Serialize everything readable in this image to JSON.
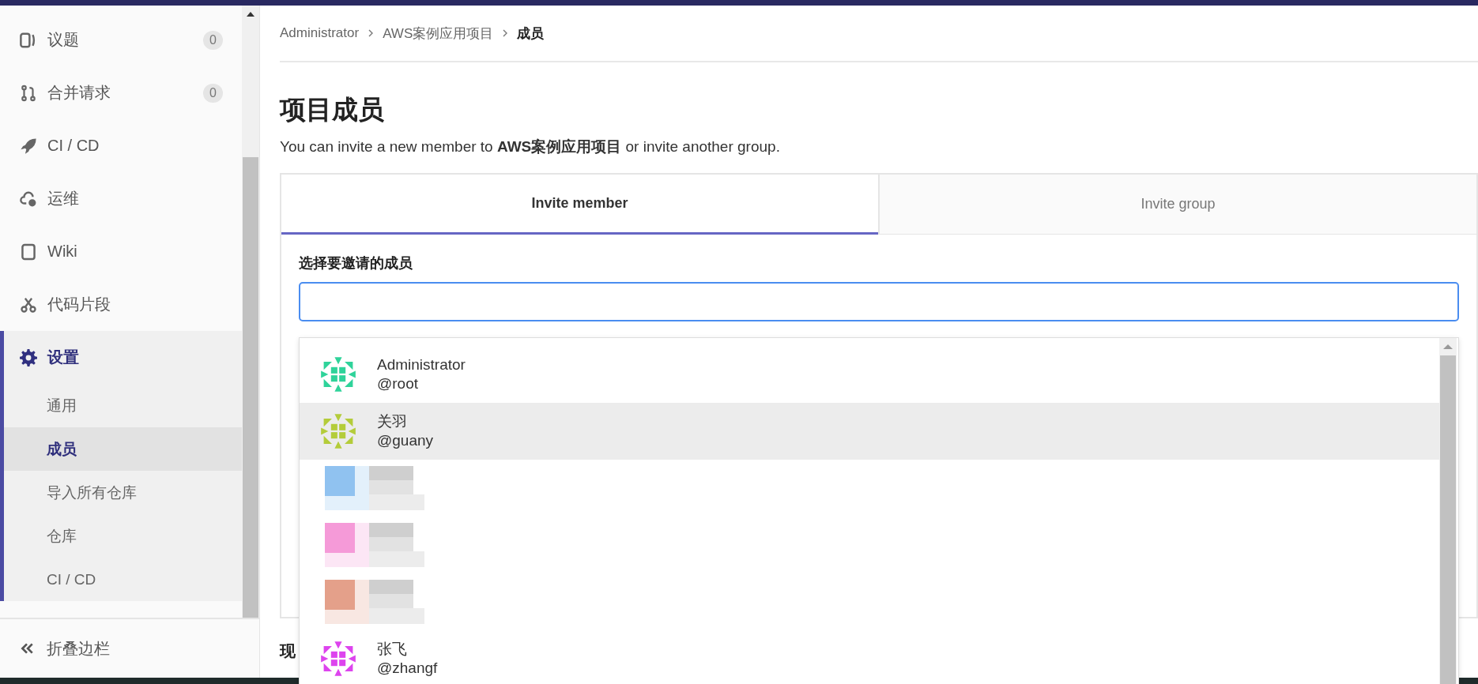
{
  "sidebar": {
    "items": [
      {
        "label": "议题",
        "badge": "0"
      },
      {
        "label": "合并请求",
        "badge": "0"
      },
      {
        "label": "CI / CD"
      },
      {
        "label": "运维"
      },
      {
        "label": "Wiki"
      },
      {
        "label": "代码片段"
      },
      {
        "label": "设置",
        "expanded": true,
        "children": [
          {
            "label": "通用",
            "selected": false
          },
          {
            "label": "成员",
            "selected": true
          },
          {
            "label": "导入所有仓库",
            "selected": false
          },
          {
            "label": "仓库",
            "selected": false
          },
          {
            "label": "CI / CD",
            "selected": false
          }
        ]
      }
    ],
    "collapse": "折叠边栏"
  },
  "breadcrumb": [
    "Administrator",
    "AWS案例应用项目",
    "成员"
  ],
  "title": "项目成员",
  "description": "You can invite a new member to **AWS案例应用项目** or invite another group.",
  "tabs": [
    {
      "label": "Invite member",
      "selected": true
    },
    {
      "label": "Invite group",
      "selected": false
    }
  ],
  "invite": {
    "label": "选择要邀请的成员"
  },
  "dropdown": [
    {
      "kind": "user",
      "name": "Administrator",
      "handle": "@root",
      "color": "#2fd39a",
      "selected": false
    },
    {
      "kind": "user",
      "name": "关羽",
      "handle": "@guany",
      "color": "#b4cc3a",
      "selected": true
    },
    {
      "kind": "redacted",
      "color": "#90c2f0",
      "selected": false
    },
    {
      "kind": "redacted",
      "color": "#f59ad8",
      "selected": false
    },
    {
      "kind": "redacted",
      "color": "#e4a08a",
      "selected": false
    },
    {
      "kind": "user",
      "name": "张飞",
      "handle": "@zhangf",
      "color": "#dd44ee",
      "selected": false
    }
  ],
  "section_heading": "现"
}
